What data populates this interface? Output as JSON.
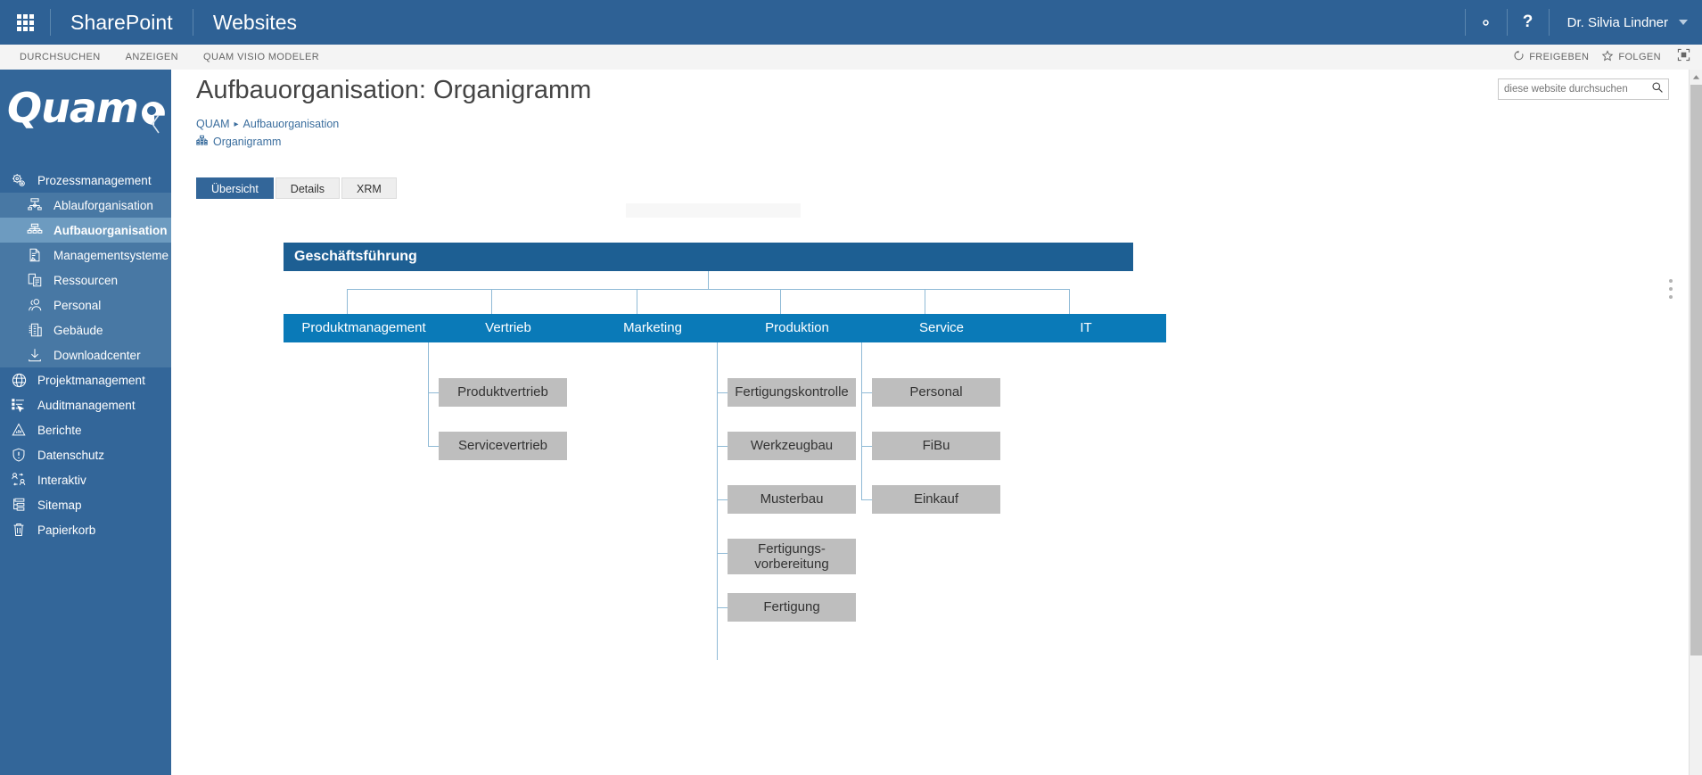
{
  "suitebar": {
    "waffle": "app-launcher",
    "brand": "SharePoint",
    "site": "Websites",
    "settings_icon": "gear-icon",
    "help_label": "?",
    "user": "Dr. Silvia Lindner",
    "brand_color": "#2e6195"
  },
  "ribbon": {
    "tabs": [
      {
        "label": "DURCHSUCHEN"
      },
      {
        "label": "ANZEIGEN"
      },
      {
        "label": "QUAM VISIO MODELER"
      }
    ],
    "share_label": "FREIGEBEN",
    "follow_label": "FOLGEN",
    "focus_icon": "focus-on-content-icon"
  },
  "sidebar": {
    "logo_text": "Quam",
    "collapse_icon": "chevron-left-icon",
    "bg_color": "#336699",
    "selected_color": "#6d9bc0",
    "items": [
      {
        "label": "Prozessmanagement",
        "icon": "gears-icon",
        "level": 1,
        "selected": false
      },
      {
        "label": "Ablauforganisation",
        "icon": "process-flow-icon",
        "level": 2,
        "selected": false
      },
      {
        "label": "Aufbauorganisation",
        "icon": "org-chart-icon",
        "level": 2,
        "selected": true
      },
      {
        "label": "Managementsysteme",
        "icon": "document-edit-icon",
        "level": 2,
        "selected": false
      },
      {
        "label": "Ressourcen",
        "icon": "resources-icon",
        "level": 2,
        "selected": false
      },
      {
        "label": "Personal",
        "icon": "people-icon",
        "level": 2,
        "selected": false
      },
      {
        "label": "Gebäude",
        "icon": "building-icon",
        "level": 2,
        "selected": false
      },
      {
        "label": "Downloadcenter",
        "icon": "download-icon",
        "level": 2,
        "selected": false
      },
      {
        "label": "Projektmanagement",
        "icon": "globe-icon",
        "level": 1,
        "selected": false
      },
      {
        "label": "Auditmanagement",
        "icon": "checklist-cursor-icon",
        "level": 1,
        "selected": false
      },
      {
        "label": "Berichte",
        "icon": "report-chart-icon",
        "level": 1,
        "selected": false
      },
      {
        "label": "Datenschutz",
        "icon": "shield-icon",
        "level": 1,
        "selected": false
      },
      {
        "label": "Interaktiv",
        "icon": "user-exchange-icon",
        "level": 1,
        "selected": false
      },
      {
        "label": "Sitemap",
        "icon": "sitemap-icon",
        "level": 1,
        "selected": false
      },
      {
        "label": "Papierkorb",
        "icon": "trash-icon",
        "level": 1,
        "selected": false
      }
    ]
  },
  "search": {
    "placeholder": "diese website durchsuchen",
    "value": "",
    "icon": "search-icon"
  },
  "main": {
    "title": "Aufbauorganisation: Organigramm",
    "breadcrumb": [
      {
        "label": "QUAM"
      },
      {
        "label": "Aufbauorganisation"
      }
    ],
    "breadcrumb_separator": "▸",
    "subtitle": "Organigramm",
    "subtitle_icon": "org-chart-icon",
    "tabs": [
      {
        "label": "Übersicht",
        "active": true
      },
      {
        "label": "Details",
        "active": false
      },
      {
        "label": "XRM",
        "active": false
      }
    ]
  },
  "chart_data": {
    "type": "diagram",
    "title": "Organigramm",
    "colors": {
      "root": "#1d5f93",
      "level2": "#0a7ab8",
      "level3": "#bebebe",
      "connector": "#8fbad6"
    },
    "root": {
      "label": "Geschäftsführung"
    },
    "level2": [
      {
        "label": "Produktmanagement",
        "children": []
      },
      {
        "label": "Vertrieb",
        "children": [
          "Produktvertrieb",
          "Servicevertrieb"
        ]
      },
      {
        "label": "Marketing",
        "children": []
      },
      {
        "label": "Produktion",
        "children": [
          "Fertigungskontrolle",
          "Werkzeugbau",
          "Musterbau",
          "Fertigungs-vorbereitung",
          "Fertigung"
        ]
      },
      {
        "label": "Service",
        "children": [
          "Personal",
          "FiBu",
          "Einkauf"
        ]
      },
      {
        "label": "IT",
        "children": []
      }
    ],
    "nodes": [
      {
        "id": "root",
        "label": "Geschäftsführung",
        "level": 1
      },
      {
        "id": "produktmanagement",
        "label": "Produktmanagement",
        "level": 2
      },
      {
        "id": "vertrieb",
        "label": "Vertrieb",
        "level": 2
      },
      {
        "id": "marketing",
        "label": "Marketing",
        "level": 2
      },
      {
        "id": "produktion",
        "label": "Produktion",
        "level": 2
      },
      {
        "id": "service",
        "label": "Service",
        "level": 2
      },
      {
        "id": "it",
        "label": "IT",
        "level": 2
      },
      {
        "id": "produktvertrieb",
        "label": "Produktvertrieb",
        "level": 3,
        "parent": "vertrieb"
      },
      {
        "id": "servicevertrieb",
        "label": "Servicevertrieb",
        "level": 3,
        "parent": "vertrieb"
      },
      {
        "id": "fertigungskontrolle",
        "label": "Fertigungskontrolle",
        "level": 3,
        "parent": "produktion"
      },
      {
        "id": "werkzeugbau",
        "label": "Werkzeugbau",
        "level": 3,
        "parent": "produktion"
      },
      {
        "id": "musterbau",
        "label": "Musterbau",
        "level": 3,
        "parent": "produktion"
      },
      {
        "id": "fertigungsvorbereitung",
        "label": "Fertigungs-\nvorbereitung",
        "level": 3,
        "parent": "produktion"
      },
      {
        "id": "fertigung",
        "label": "Fertigung",
        "level": 3,
        "parent": "produktion"
      },
      {
        "id": "personal",
        "label": "Personal",
        "level": 3,
        "parent": "service"
      },
      {
        "id": "fibu",
        "label": "FiBu",
        "level": 3,
        "parent": "service"
      },
      {
        "id": "einkauf",
        "label": "Einkauf",
        "level": 3,
        "parent": "service"
      }
    ]
  }
}
